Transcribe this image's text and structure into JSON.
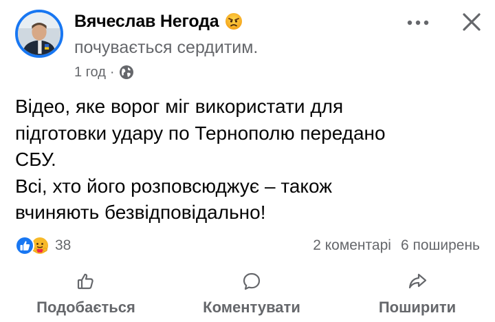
{
  "post": {
    "author": "Вячеслав Негода",
    "feeling": "почувається сердитим.",
    "time": "1 год",
    "separator": "·",
    "audience_icon": "globe-icon",
    "feeling_icon": "angry-face-icon",
    "text_lines": [
      "Відео, яке ворог міг використати для",
      "підготовки удару по Тернополю передано",
      "СБУ.",
      "Всі, хто його розповсюджує – також",
      "вчиняють безвідповідально!"
    ]
  },
  "stats": {
    "reaction_icons": [
      "like-icon",
      "care-icon"
    ],
    "reaction_count": "38",
    "comments": "2 коментарі",
    "shares": "6 поширень"
  },
  "actions": {
    "like_label": "Подобається",
    "comment_label": "Коментувати",
    "share_label": "Поширити"
  },
  "colors": {
    "accent": "#1877f2",
    "secondary_text": "#65676b",
    "primary_text": "#050505"
  }
}
